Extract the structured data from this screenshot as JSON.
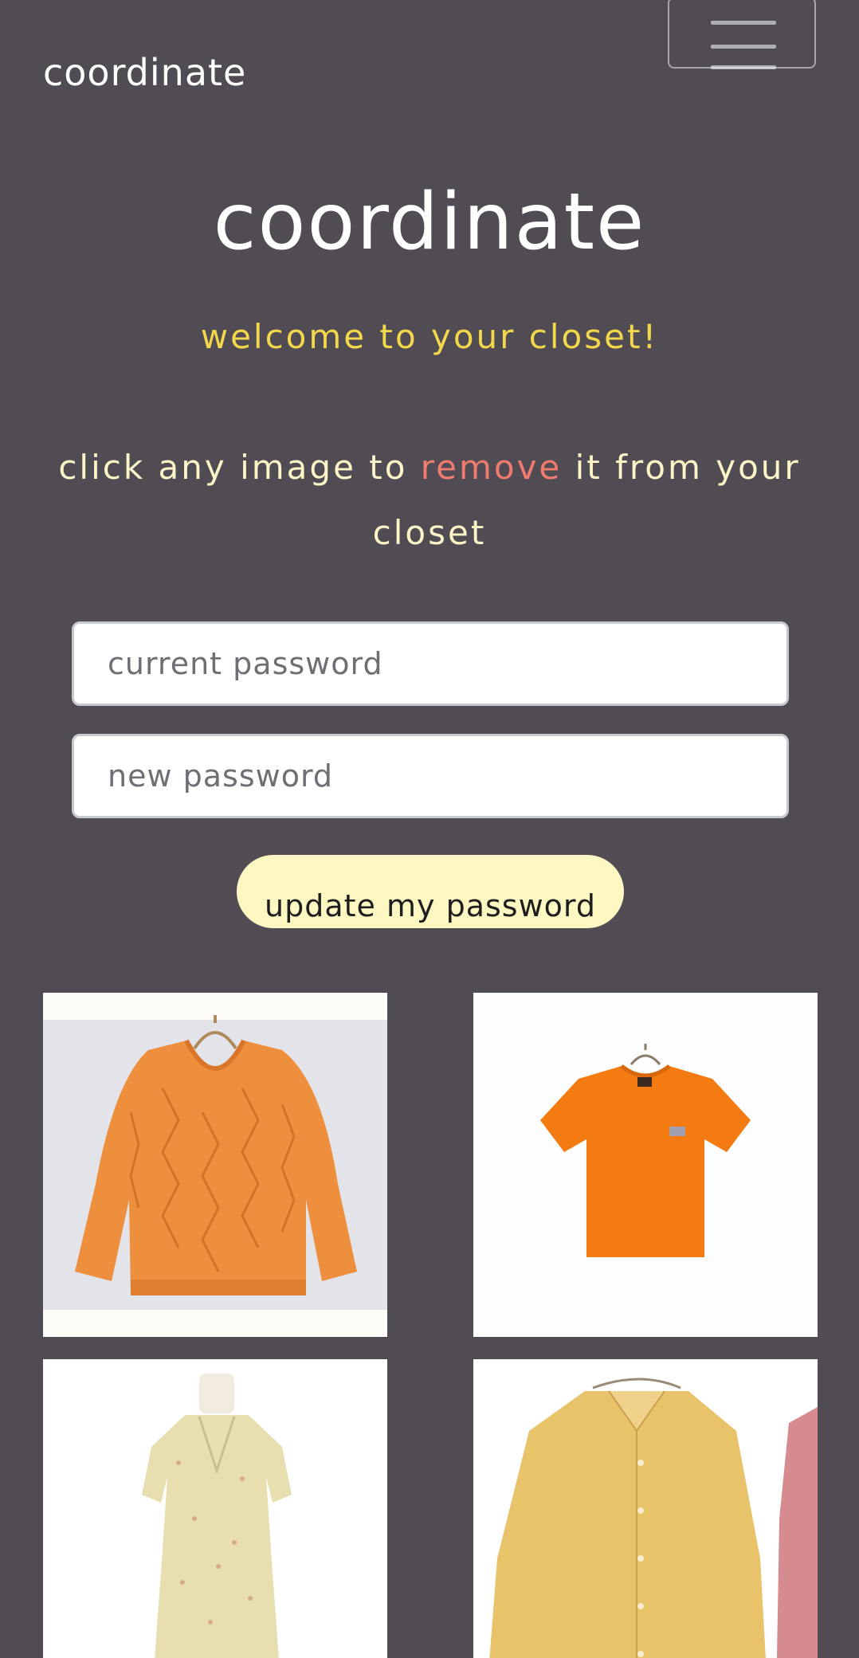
{
  "navbar": {
    "brand": "coordinate",
    "menu_icon": "hamburger-menu-icon"
  },
  "hero": {
    "title": "coordinate",
    "welcome": "welcome to your closet!",
    "instruction_before": "click any image to ",
    "instruction_highlight": "remove",
    "instruction_after": " it from your closet"
  },
  "form": {
    "current_password_placeholder": "current password",
    "new_password_placeholder": "new password",
    "submit_label": "update my password"
  },
  "closet": {
    "items": [
      {
        "kind": "orange knit sweater",
        "color": "#ee8f3d"
      },
      {
        "kind": "orange t-shirt",
        "color": "#f47a12"
      },
      {
        "kind": "floral dress",
        "color": "#e7dfb0"
      },
      {
        "kind": "mustard shirt",
        "color": "#e8c36a"
      }
    ]
  },
  "colors": {
    "background": "#514c54",
    "welcome": "#f2d84a",
    "instruction": "#fbf5c8",
    "highlight": "#f07b6f",
    "button": "#fdf7c2"
  }
}
